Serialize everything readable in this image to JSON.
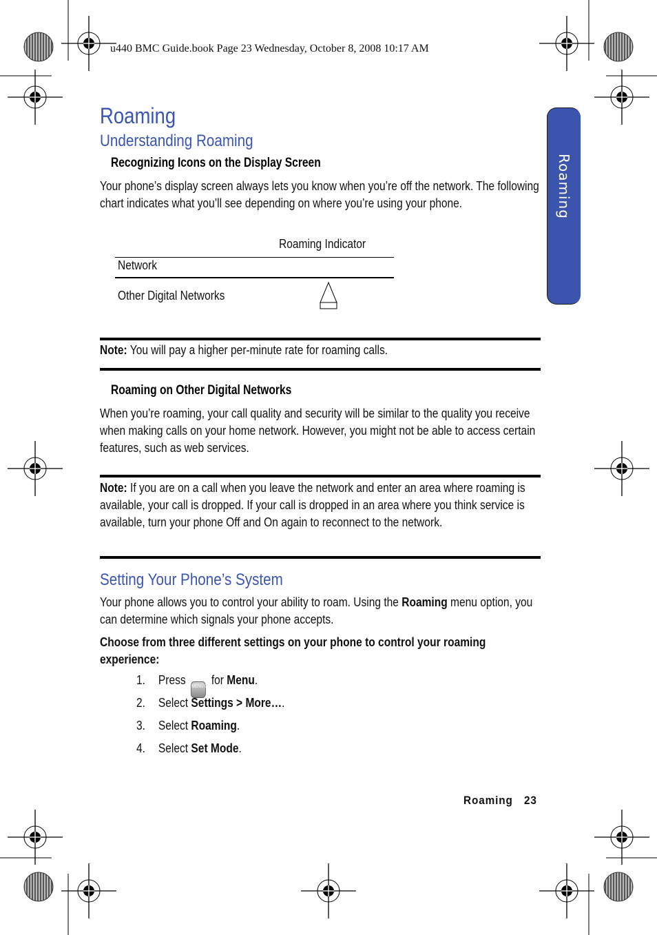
{
  "print_header": "u440 BMC Guide.book  Page 23  Wednesday, October 8, 2008  10:17 AM",
  "side_tab": {
    "label": "Roaming",
    "color": "#3b54ae"
  },
  "title": "Roaming",
  "section1": {
    "heading": "Understanding Roaming",
    "subheading": "Recognizing Icons on the Display Screen",
    "intro": "Your phone’s display screen always lets you know when you’re off the network. The following chart indicates what you’ll see depending on where you’re using your phone.",
    "table": {
      "headers": [
        "Network",
        "Roaming Indicator"
      ],
      "rows": [
        {
          "network": "Other Digital Networks",
          "indicator_icon": "roaming-triangle-icon"
        }
      ]
    },
    "note1": {
      "label": "Note:",
      "text": " You will pay a higher per-minute rate for roaming calls."
    },
    "subheading2": "Roaming on Other Digital Networks",
    "para2": "When you’re roaming, your call quality and security will be similar to the quality you receive when making calls on your home network. However, you might not be able to access certain features, such as web services.",
    "note2": {
      "label": "Note:",
      "text": " If you are on a call when you leave the network and enter an area where roaming is available, your call is dropped. If your call is dropped in an area where you think service is available, turn your phone Off and On again to reconnect to the network."
    }
  },
  "section2": {
    "heading": "Setting Your Phone’s System",
    "para_pre": "Your phone allows you to control your ability to roam. Using the ",
    "para_bold": "Roaming",
    "para_post": " menu option, you can determine which signals your phone accepts.",
    "instruction": "Choose from three different settings on your phone to control your roaming experience:",
    "steps": [
      {
        "num": "1.",
        "pre": "Press ",
        "key": "MENU OK",
        "mid": " for ",
        "bold": "Menu",
        "post": "."
      },
      {
        "num": "2.",
        "pre": "Select ",
        "bold": "Settings > More…",
        "post": "."
      },
      {
        "num": "3.",
        "pre": "Select ",
        "bold": "Roaming",
        "post": "."
      },
      {
        "num": "4.",
        "pre": "Select ",
        "bold": "Set Mode",
        "post": "."
      }
    ]
  },
  "footer": {
    "section": "Roaming",
    "page": "23"
  },
  "colors": {
    "heading": "#3a55b5",
    "tab": "#3b54ae"
  }
}
